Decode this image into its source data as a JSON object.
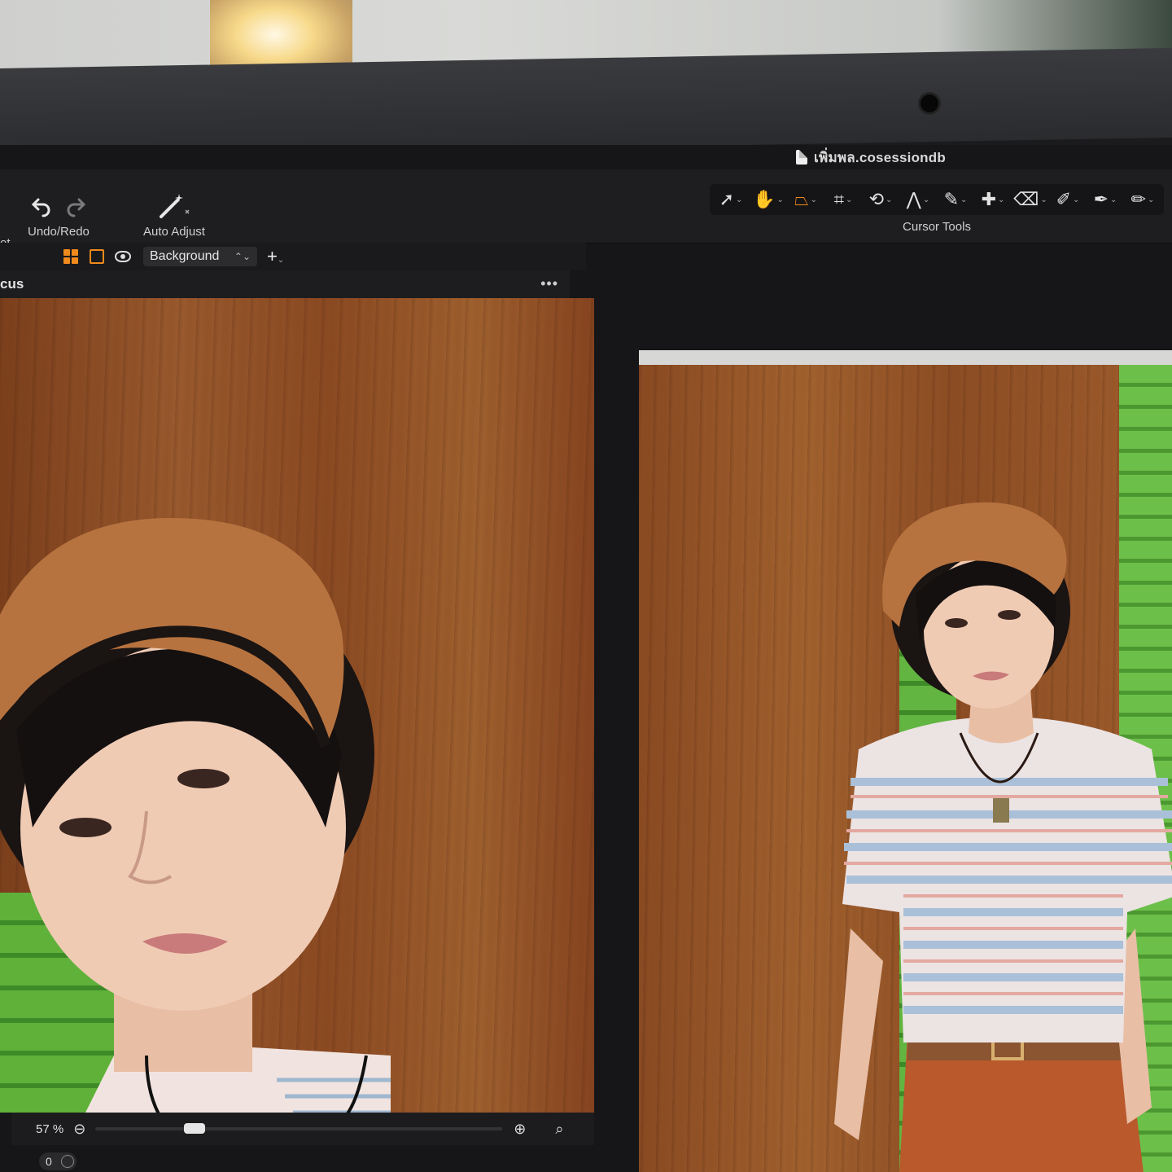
{
  "window": {
    "document_title": "เพิ่มพล.cosessiondb"
  },
  "toolbar": {
    "set_label": "et",
    "undo_redo_label": "Undo/Redo",
    "auto_adjust_label": "Auto Adjust",
    "cursor_tools_label": "Cursor Tools",
    "cursor_tools": [
      {
        "name": "select-icon",
        "glyph": "➚"
      },
      {
        "name": "hand-pan-icon",
        "glyph": "✋"
      },
      {
        "name": "background-mask-icon",
        "glyph": "⏢",
        "active": true
      },
      {
        "name": "crop-icon",
        "glyph": "⌗"
      },
      {
        "name": "rotate-icon",
        "glyph": "⟲"
      },
      {
        "name": "keystone-icon",
        "glyph": "⋀"
      },
      {
        "name": "brush-icon",
        "glyph": "✎"
      },
      {
        "name": "heal-icon",
        "glyph": "✚"
      },
      {
        "name": "eraser-icon",
        "glyph": "⌫"
      },
      {
        "name": "gradient-icon",
        "glyph": "✐"
      },
      {
        "name": "color-picker-icon",
        "glyph": "✒"
      },
      {
        "name": "annotate-icon",
        "glyph": "✏"
      }
    ]
  },
  "subbar": {
    "layer_select": "Background"
  },
  "panel": {
    "title": "cus",
    "menu": "•••"
  },
  "statusbar": {
    "zoom": "57 %",
    "zoom_fraction": 0.23
  },
  "toggle": {
    "value": "0"
  },
  "colors": {
    "accent": "#f08a1c",
    "background": "#161618"
  }
}
